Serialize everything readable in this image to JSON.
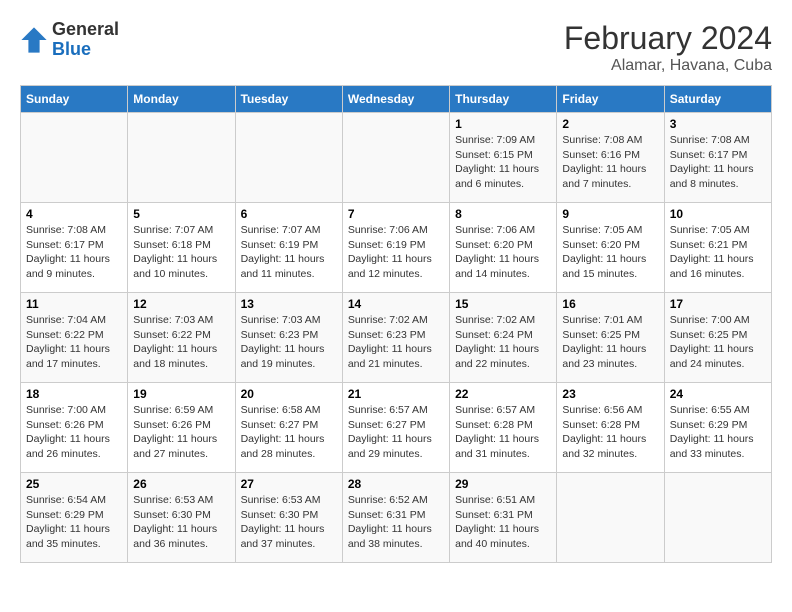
{
  "header": {
    "logo_general": "General",
    "logo_blue": "Blue",
    "main_title": "February 2024",
    "subtitle": "Alamar, Havana, Cuba"
  },
  "days_of_week": [
    "Sunday",
    "Monday",
    "Tuesday",
    "Wednesday",
    "Thursday",
    "Friday",
    "Saturday"
  ],
  "weeks": [
    [
      {
        "day": "",
        "info": ""
      },
      {
        "day": "",
        "info": ""
      },
      {
        "day": "",
        "info": ""
      },
      {
        "day": "",
        "info": ""
      },
      {
        "day": "1",
        "info": "Sunrise: 7:09 AM\nSunset: 6:15 PM\nDaylight: 11 hours and 6 minutes."
      },
      {
        "day": "2",
        "info": "Sunrise: 7:08 AM\nSunset: 6:16 PM\nDaylight: 11 hours and 7 minutes."
      },
      {
        "day": "3",
        "info": "Sunrise: 7:08 AM\nSunset: 6:17 PM\nDaylight: 11 hours and 8 minutes."
      }
    ],
    [
      {
        "day": "4",
        "info": "Sunrise: 7:08 AM\nSunset: 6:17 PM\nDaylight: 11 hours and 9 minutes."
      },
      {
        "day": "5",
        "info": "Sunrise: 7:07 AM\nSunset: 6:18 PM\nDaylight: 11 hours and 10 minutes."
      },
      {
        "day": "6",
        "info": "Sunrise: 7:07 AM\nSunset: 6:19 PM\nDaylight: 11 hours and 11 minutes."
      },
      {
        "day": "7",
        "info": "Sunrise: 7:06 AM\nSunset: 6:19 PM\nDaylight: 11 hours and 12 minutes."
      },
      {
        "day": "8",
        "info": "Sunrise: 7:06 AM\nSunset: 6:20 PM\nDaylight: 11 hours and 14 minutes."
      },
      {
        "day": "9",
        "info": "Sunrise: 7:05 AM\nSunset: 6:20 PM\nDaylight: 11 hours and 15 minutes."
      },
      {
        "day": "10",
        "info": "Sunrise: 7:05 AM\nSunset: 6:21 PM\nDaylight: 11 hours and 16 minutes."
      }
    ],
    [
      {
        "day": "11",
        "info": "Sunrise: 7:04 AM\nSunset: 6:22 PM\nDaylight: 11 hours and 17 minutes."
      },
      {
        "day": "12",
        "info": "Sunrise: 7:03 AM\nSunset: 6:22 PM\nDaylight: 11 hours and 18 minutes."
      },
      {
        "day": "13",
        "info": "Sunrise: 7:03 AM\nSunset: 6:23 PM\nDaylight: 11 hours and 19 minutes."
      },
      {
        "day": "14",
        "info": "Sunrise: 7:02 AM\nSunset: 6:23 PM\nDaylight: 11 hours and 21 minutes."
      },
      {
        "day": "15",
        "info": "Sunrise: 7:02 AM\nSunset: 6:24 PM\nDaylight: 11 hours and 22 minutes."
      },
      {
        "day": "16",
        "info": "Sunrise: 7:01 AM\nSunset: 6:25 PM\nDaylight: 11 hours and 23 minutes."
      },
      {
        "day": "17",
        "info": "Sunrise: 7:00 AM\nSunset: 6:25 PM\nDaylight: 11 hours and 24 minutes."
      }
    ],
    [
      {
        "day": "18",
        "info": "Sunrise: 7:00 AM\nSunset: 6:26 PM\nDaylight: 11 hours and 26 minutes."
      },
      {
        "day": "19",
        "info": "Sunrise: 6:59 AM\nSunset: 6:26 PM\nDaylight: 11 hours and 27 minutes."
      },
      {
        "day": "20",
        "info": "Sunrise: 6:58 AM\nSunset: 6:27 PM\nDaylight: 11 hours and 28 minutes."
      },
      {
        "day": "21",
        "info": "Sunrise: 6:57 AM\nSunset: 6:27 PM\nDaylight: 11 hours and 29 minutes."
      },
      {
        "day": "22",
        "info": "Sunrise: 6:57 AM\nSunset: 6:28 PM\nDaylight: 11 hours and 31 minutes."
      },
      {
        "day": "23",
        "info": "Sunrise: 6:56 AM\nSunset: 6:28 PM\nDaylight: 11 hours and 32 minutes."
      },
      {
        "day": "24",
        "info": "Sunrise: 6:55 AM\nSunset: 6:29 PM\nDaylight: 11 hours and 33 minutes."
      }
    ],
    [
      {
        "day": "25",
        "info": "Sunrise: 6:54 AM\nSunset: 6:29 PM\nDaylight: 11 hours and 35 minutes."
      },
      {
        "day": "26",
        "info": "Sunrise: 6:53 AM\nSunset: 6:30 PM\nDaylight: 11 hours and 36 minutes."
      },
      {
        "day": "27",
        "info": "Sunrise: 6:53 AM\nSunset: 6:30 PM\nDaylight: 11 hours and 37 minutes."
      },
      {
        "day": "28",
        "info": "Sunrise: 6:52 AM\nSunset: 6:31 PM\nDaylight: 11 hours and 38 minutes."
      },
      {
        "day": "29",
        "info": "Sunrise: 6:51 AM\nSunset: 6:31 PM\nDaylight: 11 hours and 40 minutes."
      },
      {
        "day": "",
        "info": ""
      },
      {
        "day": "",
        "info": ""
      }
    ]
  ]
}
